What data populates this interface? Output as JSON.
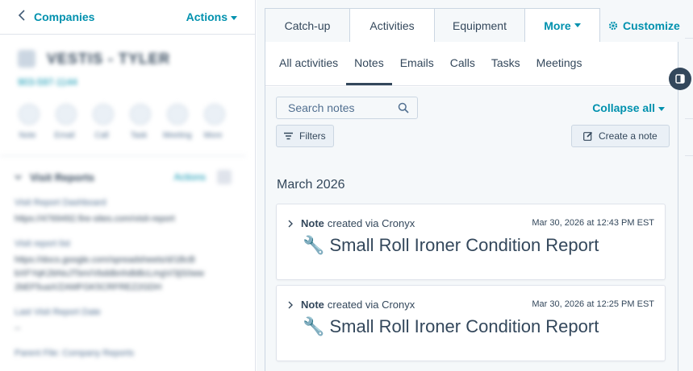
{
  "left": {
    "back_label": "Companies",
    "actions_label": "Actions",
    "company_name": "VESTIS - TYLER",
    "company_phone": "903-597-1144",
    "quick_actions": [
      "Note",
      "Email",
      "Call",
      "Task",
      "Meeting",
      "More"
    ],
    "visit_section": {
      "title": "Visit Reports",
      "actions_label": "Actions",
      "properties": [
        {
          "label": "Visit Report Dashboard",
          "value": "https://4769492.fire-sites.com/visit-report"
        },
        {
          "label": "Visit report list",
          "value": "https://docs.google.com/spreadsheets/d/1BcB bXFYqK2bNsJTbm/VbddbnhdbBcLmgV/3jS0ww 2bEF5uaX/ZAMFGK5CRFREZ2GDH"
        },
        {
          "label": "Last Visit Report Date",
          "value": "--"
        },
        {
          "label": "Parent File: Company Reports",
          "value": ""
        }
      ]
    }
  },
  "tabs": {
    "items": [
      "Catch-up",
      "Activities",
      "Equipment"
    ],
    "more_label": "More",
    "active": "Activities"
  },
  "customize_label": "Customize",
  "subtabs": {
    "items": [
      "All activities",
      "Notes",
      "Emails",
      "Calls",
      "Tasks",
      "Meetings"
    ],
    "active": "Notes"
  },
  "search": {
    "placeholder": "Search notes",
    "value": ""
  },
  "collapse_all_label": "Collapse all",
  "filters_label": "Filters",
  "create_note_label": "Create a note",
  "month_label": "March 2026",
  "notes": [
    {
      "type": "Note",
      "via": "created via Cronyx",
      "timestamp": "Mar 30, 2026 at 12:43 PM EST",
      "body": "🔧 Small Roll Ironer Condition Report"
    },
    {
      "type": "Note",
      "via": "created via Cronyx",
      "timestamp": "Mar 30, 2026 at 12:25 PM EST",
      "body": "🔧 Small Roll Ironer Condition Report"
    }
  ],
  "colors": {
    "accent": "#0091ae",
    "text": "#33475b",
    "background": "#f5f8fa",
    "border": "#cbd6e2"
  }
}
